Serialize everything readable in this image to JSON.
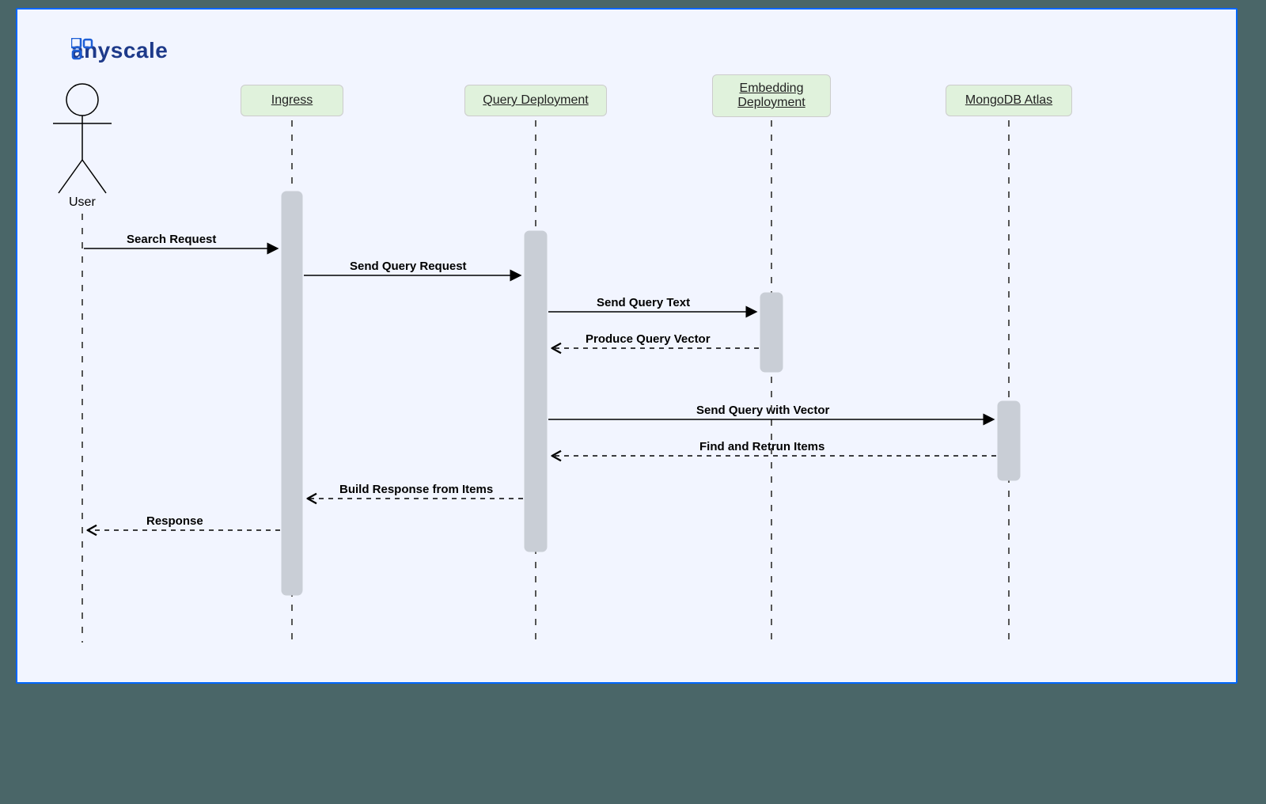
{
  "brand": "anyscale",
  "actor": "User",
  "participants": {
    "ingress": "Ingress",
    "query": "Query Deployment",
    "embedding_line1": "Embedding",
    "embedding_line2": "Deployment",
    "mongo": "MongoDB Atlas"
  },
  "messages": {
    "m1": "Search Request",
    "m2": "Send Query Request",
    "m3": "Send Query Text",
    "m4": "Produce Query Vector",
    "m5": "Send Query with Vector",
    "m6": "Find and Retrun Items",
    "m7": "Build Response from Items",
    "m8": "Response"
  }
}
